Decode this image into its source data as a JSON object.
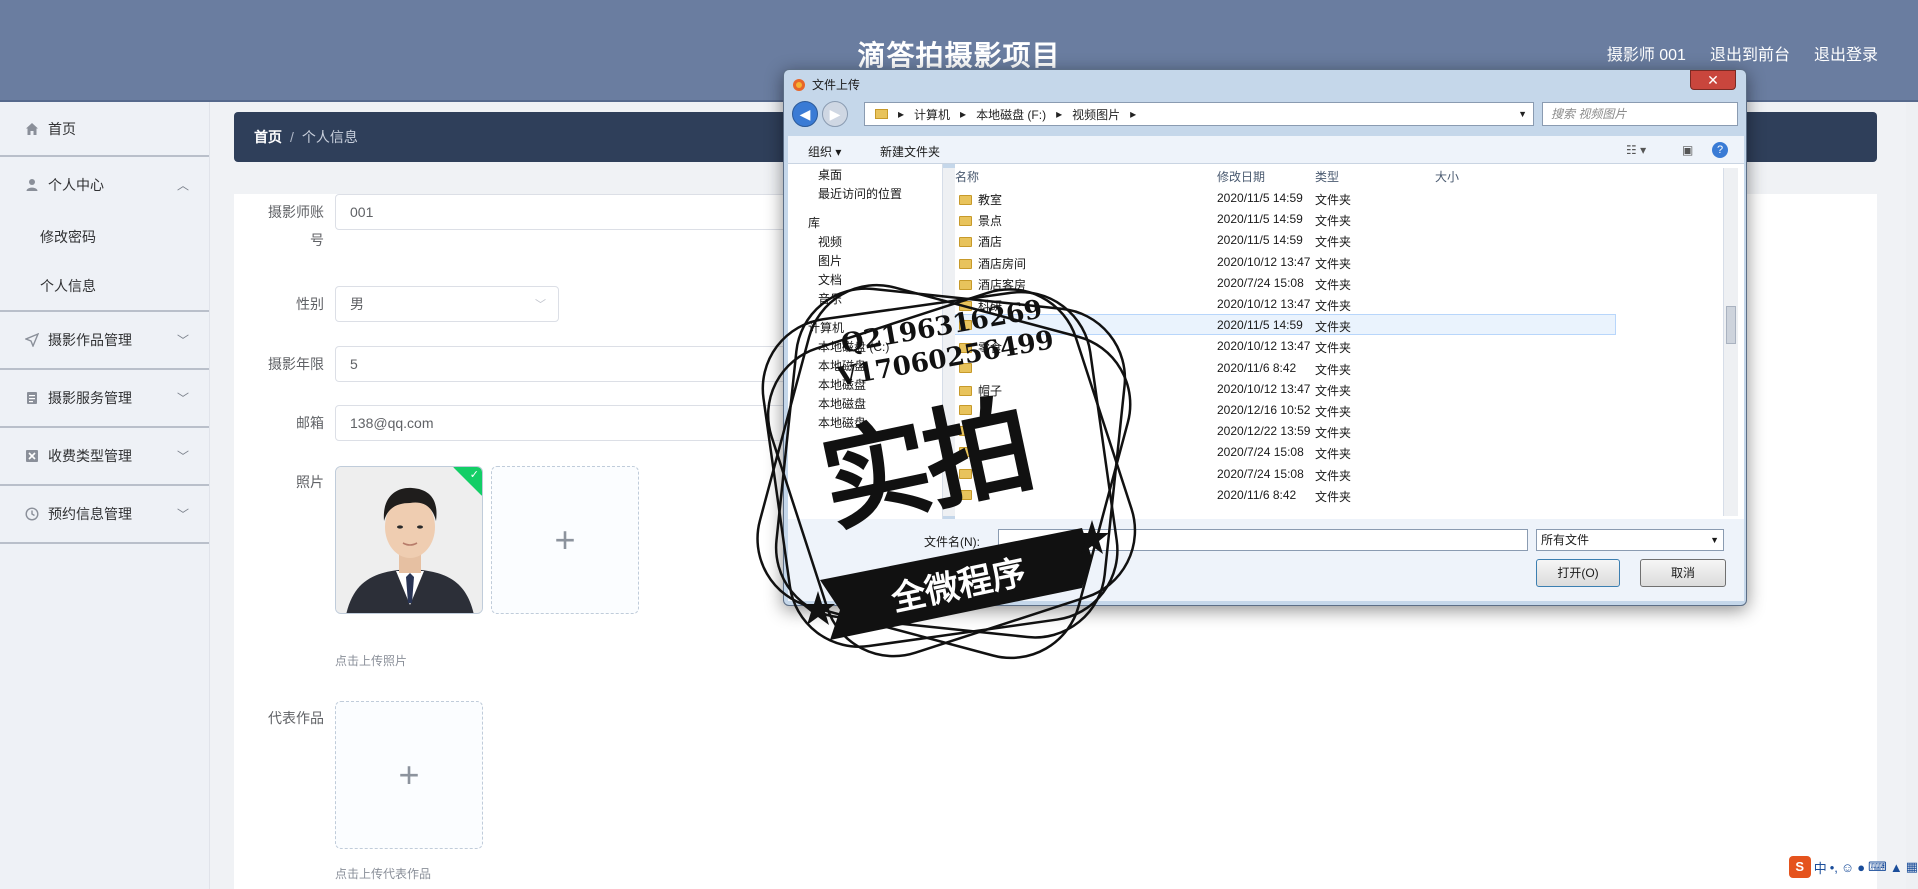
{
  "header": {
    "title": "滴答拍摄影项目",
    "links": [
      "摄影师 001",
      "退出到前台",
      "退出登录"
    ]
  },
  "sidebar": {
    "items": [
      {
        "label": "首页",
        "icon": "home-icon"
      },
      {
        "label": "个人中心",
        "icon": "user-icon",
        "expanded": true,
        "children": [
          "修改密码",
          "个人信息"
        ]
      },
      {
        "label": "摄影作品管理",
        "icon": "send-icon"
      },
      {
        "label": "摄影服务管理",
        "icon": "list-icon"
      },
      {
        "label": "收费类型管理",
        "icon": "close-box-icon"
      },
      {
        "label": "预约信息管理",
        "icon": "clock-icon"
      }
    ]
  },
  "breadcrumb": {
    "home": "首页",
    "sep": "/",
    "current": "个人信息"
  },
  "form": {
    "account_label_1": "摄影师账",
    "account_label_2": "号",
    "account_value": "001",
    "gender_label": "性别",
    "gender_value": "男",
    "years_label": "摄影年限",
    "years_value": "5",
    "email_label": "邮箱",
    "email_value": "138@qq.com",
    "photo_label": "照片",
    "photo_hint": "点击上传照片",
    "works_label": "代表作品",
    "works_hint": "点击上传代表作品",
    "plus": "+"
  },
  "dialog": {
    "title": "文件上传",
    "close": "✕",
    "path": [
      "计算机",
      "本地磁盘 (F:)",
      "视频图片"
    ],
    "search_placeholder": "搜索 视频图片",
    "toolbar_organize": "组织 ▾",
    "toolbar_newfolder": "新建文件夹",
    "tree": [
      "桌面",
      "最近访问的位置",
      "库",
      "视频",
      "图片",
      "文档",
      "音乐",
      "计算机",
      "本地磁盘 (C:)",
      "本地磁盘",
      "本地磁盘",
      "本地磁盘",
      "本地磁盘"
    ],
    "columns": [
      "名称",
      "修改日期",
      "类型",
      "大小"
    ],
    "files": [
      {
        "name": "教室",
        "date": "2020/11/5 14:59",
        "type": "文件夹"
      },
      {
        "name": "景点",
        "date": "2020/11/5 14:59",
        "type": "文件夹"
      },
      {
        "name": "酒店",
        "date": "2020/11/5 14:59",
        "type": "文件夹"
      },
      {
        "name": "酒店房间",
        "date": "2020/10/12 13:47",
        "type": "文件夹"
      },
      {
        "name": "酒店客房",
        "date": "2020/7/24 15:08",
        "type": "文件夹"
      },
      {
        "name": "科研",
        "date": "2020/10/12 13:47",
        "type": "文件夹"
      },
      {
        "name": "",
        "date": "2020/11/5 14:59",
        "type": "文件夹"
      },
      {
        "name": "零食",
        "date": "2020/10/12 13:47",
        "type": "文件夹"
      },
      {
        "name": "",
        "date": "2020/11/6 8:42",
        "type": "文件夹"
      },
      {
        "name": "帽子",
        "date": "2020/10/12 13:47",
        "type": "文件夹"
      },
      {
        "name": "",
        "date": "2020/12/16 10:52",
        "type": "文件夹"
      },
      {
        "name": "",
        "date": "2020/12/22 13:59",
        "type": "文件夹"
      },
      {
        "name": "",
        "date": "2020/7/24 15:08",
        "type": "文件夹"
      },
      {
        "name": "",
        "date": "2020/7/24 15:08",
        "type": "文件夹"
      },
      {
        "name": "",
        "date": "2020/11/6 8:42",
        "type": "文件夹"
      }
    ],
    "filename_label": "文件名(N):",
    "filter": "所有文件",
    "open": "打开(O)",
    "cancel": "取消"
  },
  "watermark": {
    "line1": "Q2196316269",
    "line2": "V17060256499",
    "big": "实拍",
    "ribbon": "全微程序"
  },
  "tray": {
    "ime": "中"
  }
}
